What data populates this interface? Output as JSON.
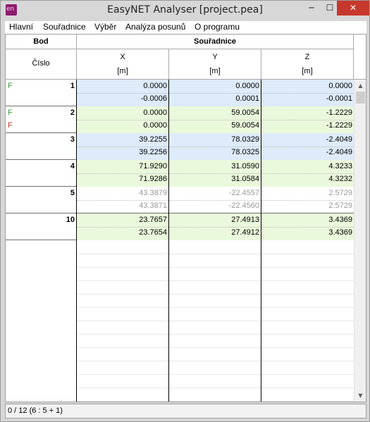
{
  "window": {
    "title": "EasyNET Analyser [project.pea]",
    "icon_text": "en",
    "minimize": "─",
    "maximize": "☐",
    "close": "✕"
  },
  "menu": [
    "Hlavní",
    "Souřadnice",
    "Výběr",
    "Analýza posunů",
    "O programu"
  ],
  "grid": {
    "header": {
      "bod": "Bod",
      "cislo": "Číslo",
      "souradnice": "Souřadnice",
      "columns": [
        {
          "name": "X",
          "unit": "[m]"
        },
        {
          "name": "Y",
          "unit": "[m]"
        },
        {
          "name": "Z",
          "unit": "[m]"
        }
      ]
    },
    "rows": [
      {
        "bod": "1",
        "flag1": "F",
        "flag2": "",
        "bg": "blue",
        "gray": false,
        "x": [
          "0.0000",
          "-0.0006"
        ],
        "y": [
          "0.0000",
          "0.0001"
        ],
        "z": [
          "0.0000",
          "-0.0001"
        ]
      },
      {
        "bod": "2",
        "flag1": "F",
        "flag2": "F",
        "bg": "green",
        "gray": false,
        "x": [
          "0.0000",
          "0.0000"
        ],
        "y": [
          "59.0054",
          "59.0054"
        ],
        "z": [
          "-1.2229",
          "-1.2229"
        ]
      },
      {
        "bod": "3",
        "flag1": "",
        "flag2": "",
        "bg": "blue",
        "gray": false,
        "x": [
          "39.2255",
          "39.2256"
        ],
        "y": [
          "78.0329",
          "78.0325"
        ],
        "z": [
          "-2.4049",
          "-2.4049"
        ]
      },
      {
        "bod": "4",
        "flag1": "",
        "flag2": "",
        "bg": "green",
        "gray": false,
        "x": [
          "71.9290",
          "71.9286"
        ],
        "y": [
          "31.0590",
          "31.0584"
        ],
        "z": [
          "4.3233",
          "4.3232"
        ]
      },
      {
        "bod": "5",
        "flag1": "",
        "flag2": "",
        "bg": "none",
        "gray": true,
        "x": [
          "43.3879",
          "43.3871"
        ],
        "y": [
          "-22.4557",
          "-22.4560"
        ],
        "z": [
          "2.5729",
          "2.5729"
        ]
      },
      {
        "bod": "10",
        "flag1": "",
        "flag2": "",
        "bg": "green",
        "gray": false,
        "x": [
          "23.7657",
          "23.7654"
        ],
        "y": [
          "27.4913",
          "27.4912"
        ],
        "z": [
          "3.4369",
          "3.4369"
        ]
      }
    ]
  },
  "status": {
    "text": "0 / 12 (6 : 5 + 1)"
  },
  "colors": {
    "blue_row": "#ddebfa",
    "green_row": "#eaf8db",
    "flag_green": "#3a9a3a",
    "flag_red": "#c0392b",
    "gray_text": "#9a9a9a",
    "close_button": "#c7382c",
    "app_icon": "#8e1b6e"
  }
}
